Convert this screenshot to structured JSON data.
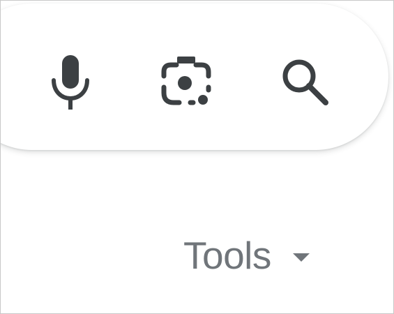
{
  "search_bar": {
    "icons": {
      "voice": "microphone-icon",
      "image": "camera-lens-icon",
      "search": "magnifier-icon"
    }
  },
  "toolbar": {
    "tools_label": "Tools",
    "tools_icon": "caret-down-icon"
  },
  "colors": {
    "icon": "#3c4043",
    "tools_text": "#70757a",
    "border": "#c8c8c8"
  }
}
